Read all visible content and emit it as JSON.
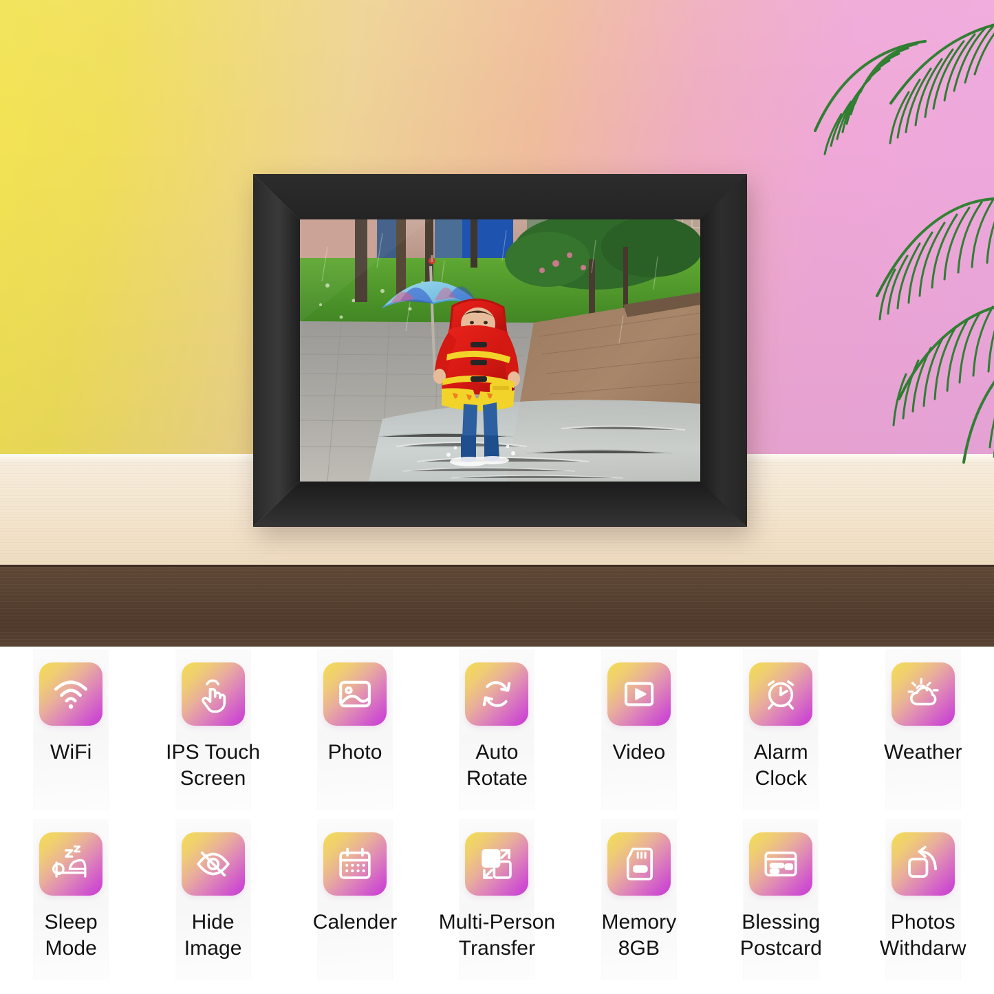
{
  "scene": {
    "name": "digital-photo-frame-product-scene",
    "wall_gradient_from": "#F2E353",
    "wall_gradient_mid": "#EFBC9C",
    "wall_gradient_to": "#EEA8DD",
    "shelf_top_color": "#F4E6D0",
    "shelf_edge_color": "#564030",
    "plant_color": "#2E7D32",
    "frame_bezel_color": "#272727",
    "frame_alt": "Black bezel digital photo frame standing on a wooden shelf",
    "photo_alt": "Child in a red firefighter raincoat holding a blue umbrella, splashing through a puddle on a wet brick path with green grass and trees behind"
  },
  "features": {
    "icon_gradient_from": "#F2DE52",
    "icon_gradient_to": "#C93ECB",
    "label_color": "#121212",
    "rows": [
      [
        {
          "label": "WiFi",
          "icon": "wifi-icon"
        },
        {
          "label": "IPS Touch\nScreen",
          "icon": "touch-hand-icon"
        },
        {
          "label": "Photo",
          "icon": "photo-icon"
        },
        {
          "label": "Auto\nRotate",
          "icon": "auto-rotate-icon"
        },
        {
          "label": "Video",
          "icon": "video-play-icon"
        },
        {
          "label": "Alarm\nClock",
          "icon": "alarm-clock-icon"
        },
        {
          "label": "Weather",
          "icon": "weather-sun-cloud-icon"
        }
      ],
      [
        {
          "label": "Sleep\nMode",
          "icon": "sleep-bed-icon"
        },
        {
          "label": "Hide\nImage",
          "icon": "eye-slash-icon"
        },
        {
          "label": "Calender",
          "icon": "calendar-icon"
        },
        {
          "label": "Multi-Person\nTransfer",
          "icon": "multi-person-transfer-icon"
        },
        {
          "label": "Memory\n8GB",
          "icon": "memory-card-icon"
        },
        {
          "label": "Blessing\nPostcard",
          "icon": "postcard-icon"
        },
        {
          "label": "Photos\nWithdarw",
          "icon": "photos-withdraw-icon"
        }
      ]
    ]
  }
}
